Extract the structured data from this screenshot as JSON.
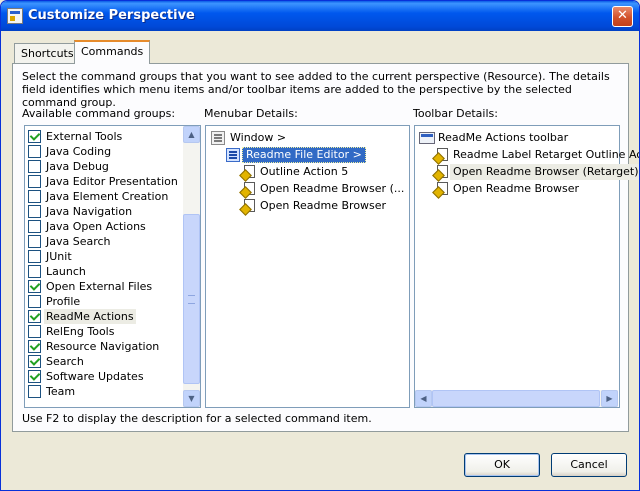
{
  "window": {
    "title": "Customize Perspective",
    "close_glyph": "✕"
  },
  "tabs": [
    {
      "label": "Shortcuts",
      "active": false
    },
    {
      "label": "Commands",
      "active": true
    }
  ],
  "description": "Select the command groups that you want to see added to the current perspective (Resource).  The details field identifies which menu items and/or toolbar items are added to the perspective by the selected command group.",
  "available": {
    "label": "Available command groups:",
    "items": [
      {
        "label": "External Tools",
        "checked": true
      },
      {
        "label": "Java Coding",
        "checked": false
      },
      {
        "label": "Java Debug",
        "checked": false
      },
      {
        "label": "Java Editor Presentation",
        "checked": false
      },
      {
        "label": "Java Element Creation",
        "checked": false
      },
      {
        "label": "Java Navigation",
        "checked": false
      },
      {
        "label": "Java Open Actions",
        "checked": false
      },
      {
        "label": "Java Search",
        "checked": false
      },
      {
        "label": "JUnit",
        "checked": false
      },
      {
        "label": "Launch",
        "checked": false
      },
      {
        "label": "Open External Files",
        "checked": true
      },
      {
        "label": "Profile",
        "checked": false
      },
      {
        "label": "ReadMe Actions",
        "checked": true,
        "selected": true
      },
      {
        "label": "RelEng Tools",
        "checked": false
      },
      {
        "label": "Resource Navigation",
        "checked": true
      },
      {
        "label": "Search",
        "checked": true
      },
      {
        "label": "Software Updates",
        "checked": true
      },
      {
        "label": "Team",
        "checked": false
      }
    ]
  },
  "menubar": {
    "label": "Menubar Details:",
    "items": [
      {
        "label": "Window  >",
        "icon": "menu-icon",
        "indent": 0
      },
      {
        "label": "Readme File Editor  >",
        "icon": "submenu-icon",
        "indent": 1,
        "selected": true
      },
      {
        "label": "Outline Action 5",
        "icon": "action-icon",
        "indent": 2
      },
      {
        "label": "Open Readme Browser (...",
        "icon": "action-icon",
        "indent": 2
      },
      {
        "label": "Open Readme Browser",
        "icon": "action-icon",
        "indent": 2
      }
    ]
  },
  "toolbar": {
    "label": "Toolbar Details:",
    "items": [
      {
        "label": "ReadMe Actions toolbar",
        "icon": "toolbar-icon",
        "indent": 0
      },
      {
        "label": "Readme Label Retarget Outline Ac...",
        "icon": "action-icon",
        "indent": 1
      },
      {
        "label": "Open Readme Browser (Retarget)",
        "icon": "action-icon",
        "indent": 1,
        "highlighted": true
      },
      {
        "label": "Open Readme Browser",
        "icon": "action-icon",
        "indent": 1
      }
    ]
  },
  "footnote": "Use F2 to display the description for a selected command item.",
  "buttons": {
    "ok": "OK",
    "cancel": "Cancel"
  },
  "colors": {
    "title_bar": "#0058ee",
    "selection": "#316ac5",
    "check": "#21a121"
  }
}
